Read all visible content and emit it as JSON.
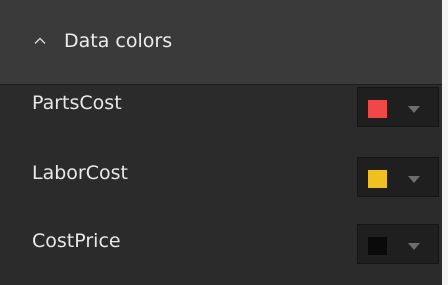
{
  "section": {
    "title": "Data colors",
    "expanded": true,
    "icon": "chevron-up-icon"
  },
  "series": [
    {
      "label": "PartsCost",
      "color": "#f04848"
    },
    {
      "label": "LaborCost",
      "color": "#f0c020"
    },
    {
      "label": "CostPrice",
      "color": "#0a0a0a"
    }
  ]
}
